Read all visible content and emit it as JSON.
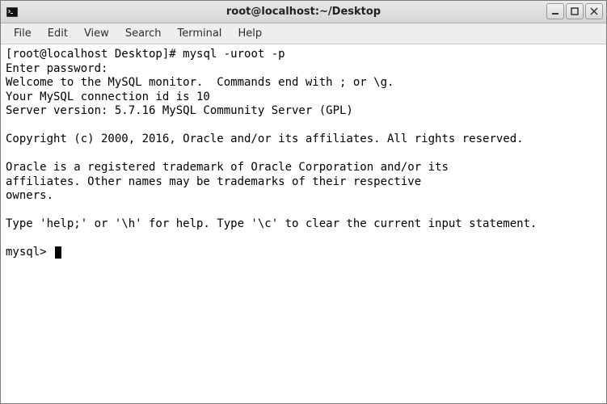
{
  "window": {
    "title": "root@localhost:~/Desktop"
  },
  "menubar": {
    "file": "File",
    "edit": "Edit",
    "view": "View",
    "search": "Search",
    "terminal": "Terminal",
    "help": "Help"
  },
  "terminal": {
    "line1_prompt": "[root@localhost Desktop]# ",
    "line1_cmd": "mysql -uroot -p",
    "line2": "Enter password: ",
    "line3": "Welcome to the MySQL monitor.  Commands end with ; or \\g.",
    "line4": "Your MySQL connection id is 10",
    "line5": "Server version: 5.7.16 MySQL Community Server (GPL)",
    "blank1": "",
    "line6": "Copyright (c) 2000, 2016, Oracle and/or its affiliates. All rights reserved.",
    "blank2": "",
    "line7": "Oracle is a registered trademark of Oracle Corporation and/or its",
    "line8": "affiliates. Other names may be trademarks of their respective",
    "line9": "owners.",
    "blank3": "",
    "line10": "Type 'help;' or '\\h' for help. Type '\\c' to clear the current input statement.",
    "blank4": "",
    "mysql_prompt": "mysql> "
  }
}
